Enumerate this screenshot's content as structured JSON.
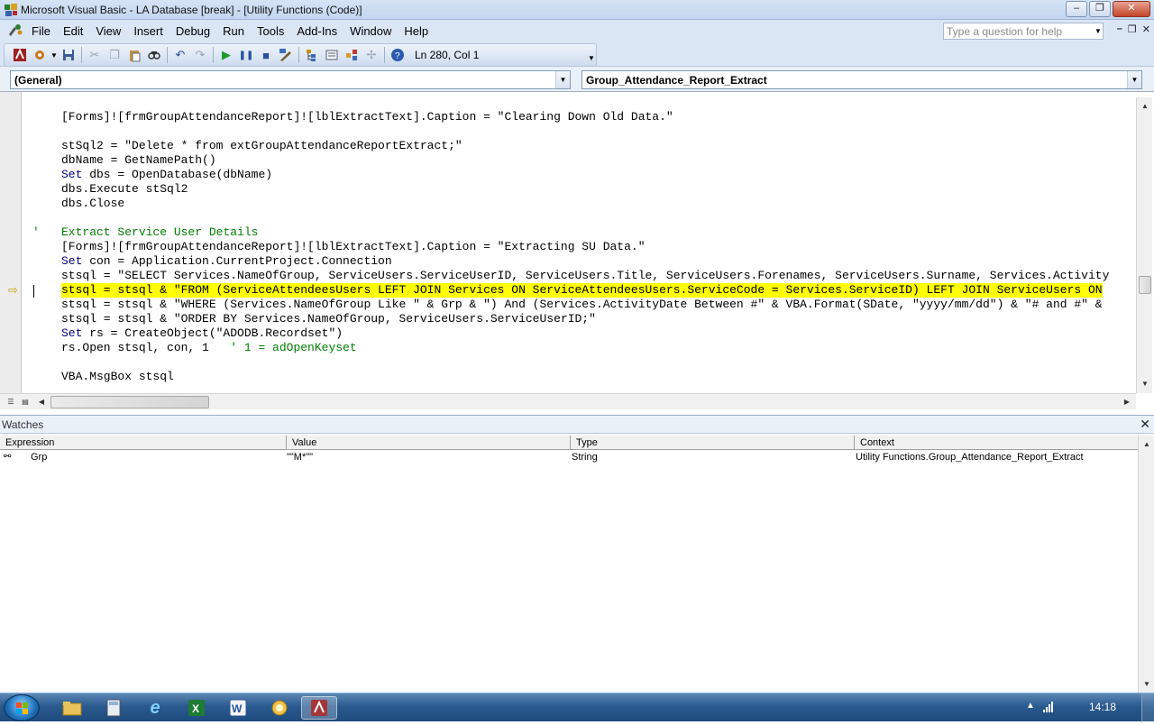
{
  "window": {
    "title": "Microsoft Visual Basic - LA Database [break] - [Utility Functions (Code)]",
    "minimize": "–",
    "maximize": "❐",
    "close": "✕"
  },
  "menu": {
    "items": [
      "File",
      "Edit",
      "View",
      "Insert",
      "Debug",
      "Run",
      "Tools",
      "Add-Ins",
      "Window",
      "Help"
    ],
    "help_placeholder": "Type a question for help"
  },
  "toolbar": {
    "position": "Ln 280, Col 1"
  },
  "combos": {
    "object": "(General)",
    "procedure": "Group_Attendance_Report_Extract"
  },
  "code": {
    "lines": [
      {
        "row": 0,
        "parts": [
          {
            "t": "[Forms]![frmGroupAttendanceReport]![lblExtractText].Caption = \"Clearing Down Old Data.\"",
            "c": ""
          }
        ]
      },
      {
        "row": 2,
        "parts": [
          {
            "t": "stSql2 = \"Delete * from extGroupAttendanceReportExtract;\"",
            "c": ""
          }
        ]
      },
      {
        "row": 3,
        "parts": [
          {
            "t": "dbName = GetNamePath()",
            "c": ""
          }
        ]
      },
      {
        "row": 4,
        "parts": [
          {
            "t": "Set",
            "c": "kw"
          },
          {
            "t": " dbs = OpenDatabase(dbName)",
            "c": ""
          }
        ]
      },
      {
        "row": 5,
        "parts": [
          {
            "t": "dbs.Execute stSql2",
            "c": ""
          }
        ]
      },
      {
        "row": 6,
        "parts": [
          {
            "t": "dbs.Close",
            "c": ""
          }
        ]
      },
      {
        "row": 8,
        "prefix": "'   ",
        "parts": [
          {
            "t": "Extract Service User Details",
            "c": "cm"
          }
        ],
        "comment": true
      },
      {
        "row": 9,
        "parts": [
          {
            "t": "[Forms]![frmGroupAttendanceReport]![lblExtractText].Caption = \"Extracting SU Data.\"",
            "c": ""
          }
        ]
      },
      {
        "row": 10,
        "parts": [
          {
            "t": "Set",
            "c": "kw"
          },
          {
            "t": " con = Application.CurrentProject.Connection",
            "c": ""
          }
        ]
      },
      {
        "row": 11,
        "parts": [
          {
            "t": "stsql = \"SELECT Services.NameOfGroup, ServiceUsers.ServiceUserID, ServiceUsers.Title, ServiceUsers.Forenames, ServiceUsers.Surname, Services.Activity",
            "c": ""
          }
        ]
      },
      {
        "row": 12,
        "highlight": true,
        "parts": [
          {
            "t": "stsql = stsql & \"FROM (ServiceAttendeesUsers LEFT JOIN Services ON ServiceAttendeesUsers.ServiceCode = Services.ServiceID) LEFT JOIN ServiceUsers ON",
            "c": ""
          }
        ]
      },
      {
        "row": 13,
        "parts": [
          {
            "t": "stsql = stsql & \"WHERE (Services.NameOfGroup Like \" & Grp & \") And (Services.ActivityDate Between #\" & VBA.Format(SDate, \"yyyy/mm/dd\") & \"# and #\" &",
            "c": ""
          }
        ]
      },
      {
        "row": 14,
        "parts": [
          {
            "t": "stsql = stsql & \"ORDER BY Services.NameOfGroup, ServiceUsers.ServiceUserID;\"",
            "c": ""
          }
        ]
      },
      {
        "row": 15,
        "parts": [
          {
            "t": "Set",
            "c": "kw"
          },
          {
            "t": " rs = CreateObject(\"ADODB.Recordset\")",
            "c": ""
          }
        ]
      },
      {
        "row": 16,
        "parts": [
          {
            "t": "rs.Open stsql, con, 1   ",
            "c": ""
          },
          {
            "t": "' 1 = adOpenKeyset",
            "c": "cm"
          }
        ]
      },
      {
        "row": 18,
        "parts": [
          {
            "t": "VBA.MsgBox stsql",
            "c": ""
          }
        ]
      }
    ]
  },
  "watches": {
    "title": "Watches",
    "columns": [
      "Expression",
      "Value",
      "Type",
      "Context"
    ],
    "rows": [
      {
        "expression": "Grp",
        "value": "\"\"M*\"\"",
        "type": "String",
        "context": "Utility Functions.Group_Attendance_Report_Extract"
      }
    ]
  },
  "taskbar": {
    "clock": "14:18"
  },
  "colors": {
    "highlight": "#ffff00",
    "keyword": "#00007f",
    "comment": "#007f00",
    "execution_arrow": "#c8a000"
  }
}
